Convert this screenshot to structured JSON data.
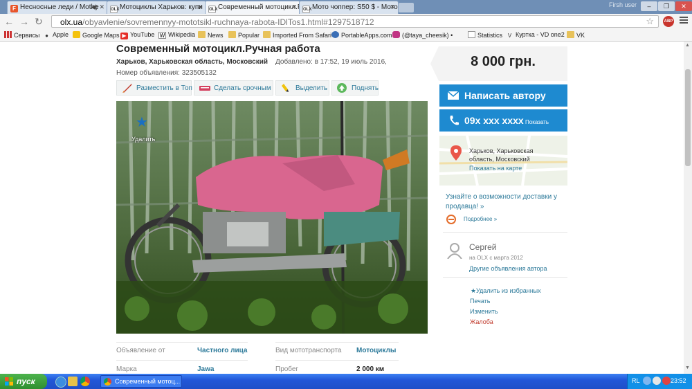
{
  "browser": {
    "tabs": [
      {
        "label": "Несносные леди / Mothe",
        "icon": "f-icon",
        "color": "#e8552b",
        "active": false
      },
      {
        "label": "Мотоциклы Харьков: купи",
        "icon": "olx-icon",
        "color": "#eef",
        "active": false
      },
      {
        "label": "Современный мотоцикл.Р",
        "icon": "olx-icon",
        "color": "#eef",
        "active": true
      },
      {
        "label": "Мото чоппер: S50 $ - Мото",
        "icon": "olx-icon",
        "color": "#eef",
        "active": false
      }
    ],
    "profile_label": "Firsh user",
    "url_host": "olx.ua",
    "url_path": "/obyavlenie/sovremennyy-mototsikl-ruchnaya-rabota-IDlTos1.html#1297518712",
    "abp_label": "ABP",
    "bookmarks": [
      {
        "label": "Сервисы",
        "icon": "apps-grid-icon"
      },
      {
        "label": "Apple",
        "icon": "apple-icon"
      },
      {
        "label": "Google Maps",
        "icon": "google-maps-icon"
      },
      {
        "label": "YouTube",
        "icon": "youtube-icon"
      },
      {
        "label": "Wikipedia",
        "icon": "wikipedia-icon"
      },
      {
        "label": "News",
        "icon": "folder-icon"
      },
      {
        "label": "Popular",
        "icon": "folder-icon"
      },
      {
        "label": "Imported From Safari",
        "icon": "folder-icon"
      },
      {
        "label": "PortableApps.com",
        "icon": "portableapps-icon"
      },
      {
        "label": "(@taya_cheesik) •",
        "icon": "instagram-icon"
      },
      {
        "label": "Statistics",
        "icon": "page-icon"
      },
      {
        "label": "Куртка - VD one2",
        "icon": "vd-icon"
      },
      {
        "label": "VK",
        "icon": "folder-icon"
      }
    ]
  },
  "listing": {
    "title": "Современный мотоцикл.Ручная работа",
    "location": "Харьков, Харьковская область, Московский",
    "added": "Добавлено: в 17:52, 19 июль 2016,",
    "ad_number": "Номер объявления: 323505132",
    "actions": [
      {
        "label": "Разместить в Топ",
        "icon": "rocket-icon"
      },
      {
        "label": "Сделать срочным",
        "icon": "urgent-badge-icon"
      },
      {
        "label": "Выделить",
        "icon": "highlighter-icon"
      },
      {
        "label": "Поднять",
        "icon": "raise-arrow-icon"
      }
    ],
    "photo_overlay_label": "Удалить",
    "details": [
      {
        "key": "Объявление от",
        "value": "Частного лица",
        "key2": "Вид мототранспорта",
        "value2": "Мотоциклы"
      },
      {
        "key": "Марка",
        "value": "Jawa",
        "key2": "Пробег",
        "value2": "2 000 км"
      }
    ]
  },
  "sidebar": {
    "price": "8 000 грн.",
    "write_label": "Написать автору",
    "phone_masked": "09x xxx xxxx",
    "phone_show": "Показать",
    "map_address": "Харьков, Харьковская область, Московский",
    "map_link": "Показать на карте",
    "delivery_text": "Узнайте о возможности доставки у продавца! »",
    "more_label": "Подробнее »",
    "seller_name": "Сергей",
    "seller_since": "на OLX с марта 2012",
    "seller_other": "Другие объявления автора",
    "links": [
      {
        "label": "Удалить из избранных",
        "red": false
      },
      {
        "label": "Печать",
        "red": false
      },
      {
        "label": "Изменить",
        "red": false
      },
      {
        "label": "Жалоба",
        "red": true
      }
    ]
  },
  "taskbar": {
    "start_label": "пуск",
    "task_label": "Современный мотоц...",
    "lang": "RL",
    "clock": "23:52"
  },
  "colors": {
    "accent": "#1e8ad0",
    "link": "#2d7a9a",
    "taskbar": "#245edb",
    "start": "#3a9b3a"
  }
}
